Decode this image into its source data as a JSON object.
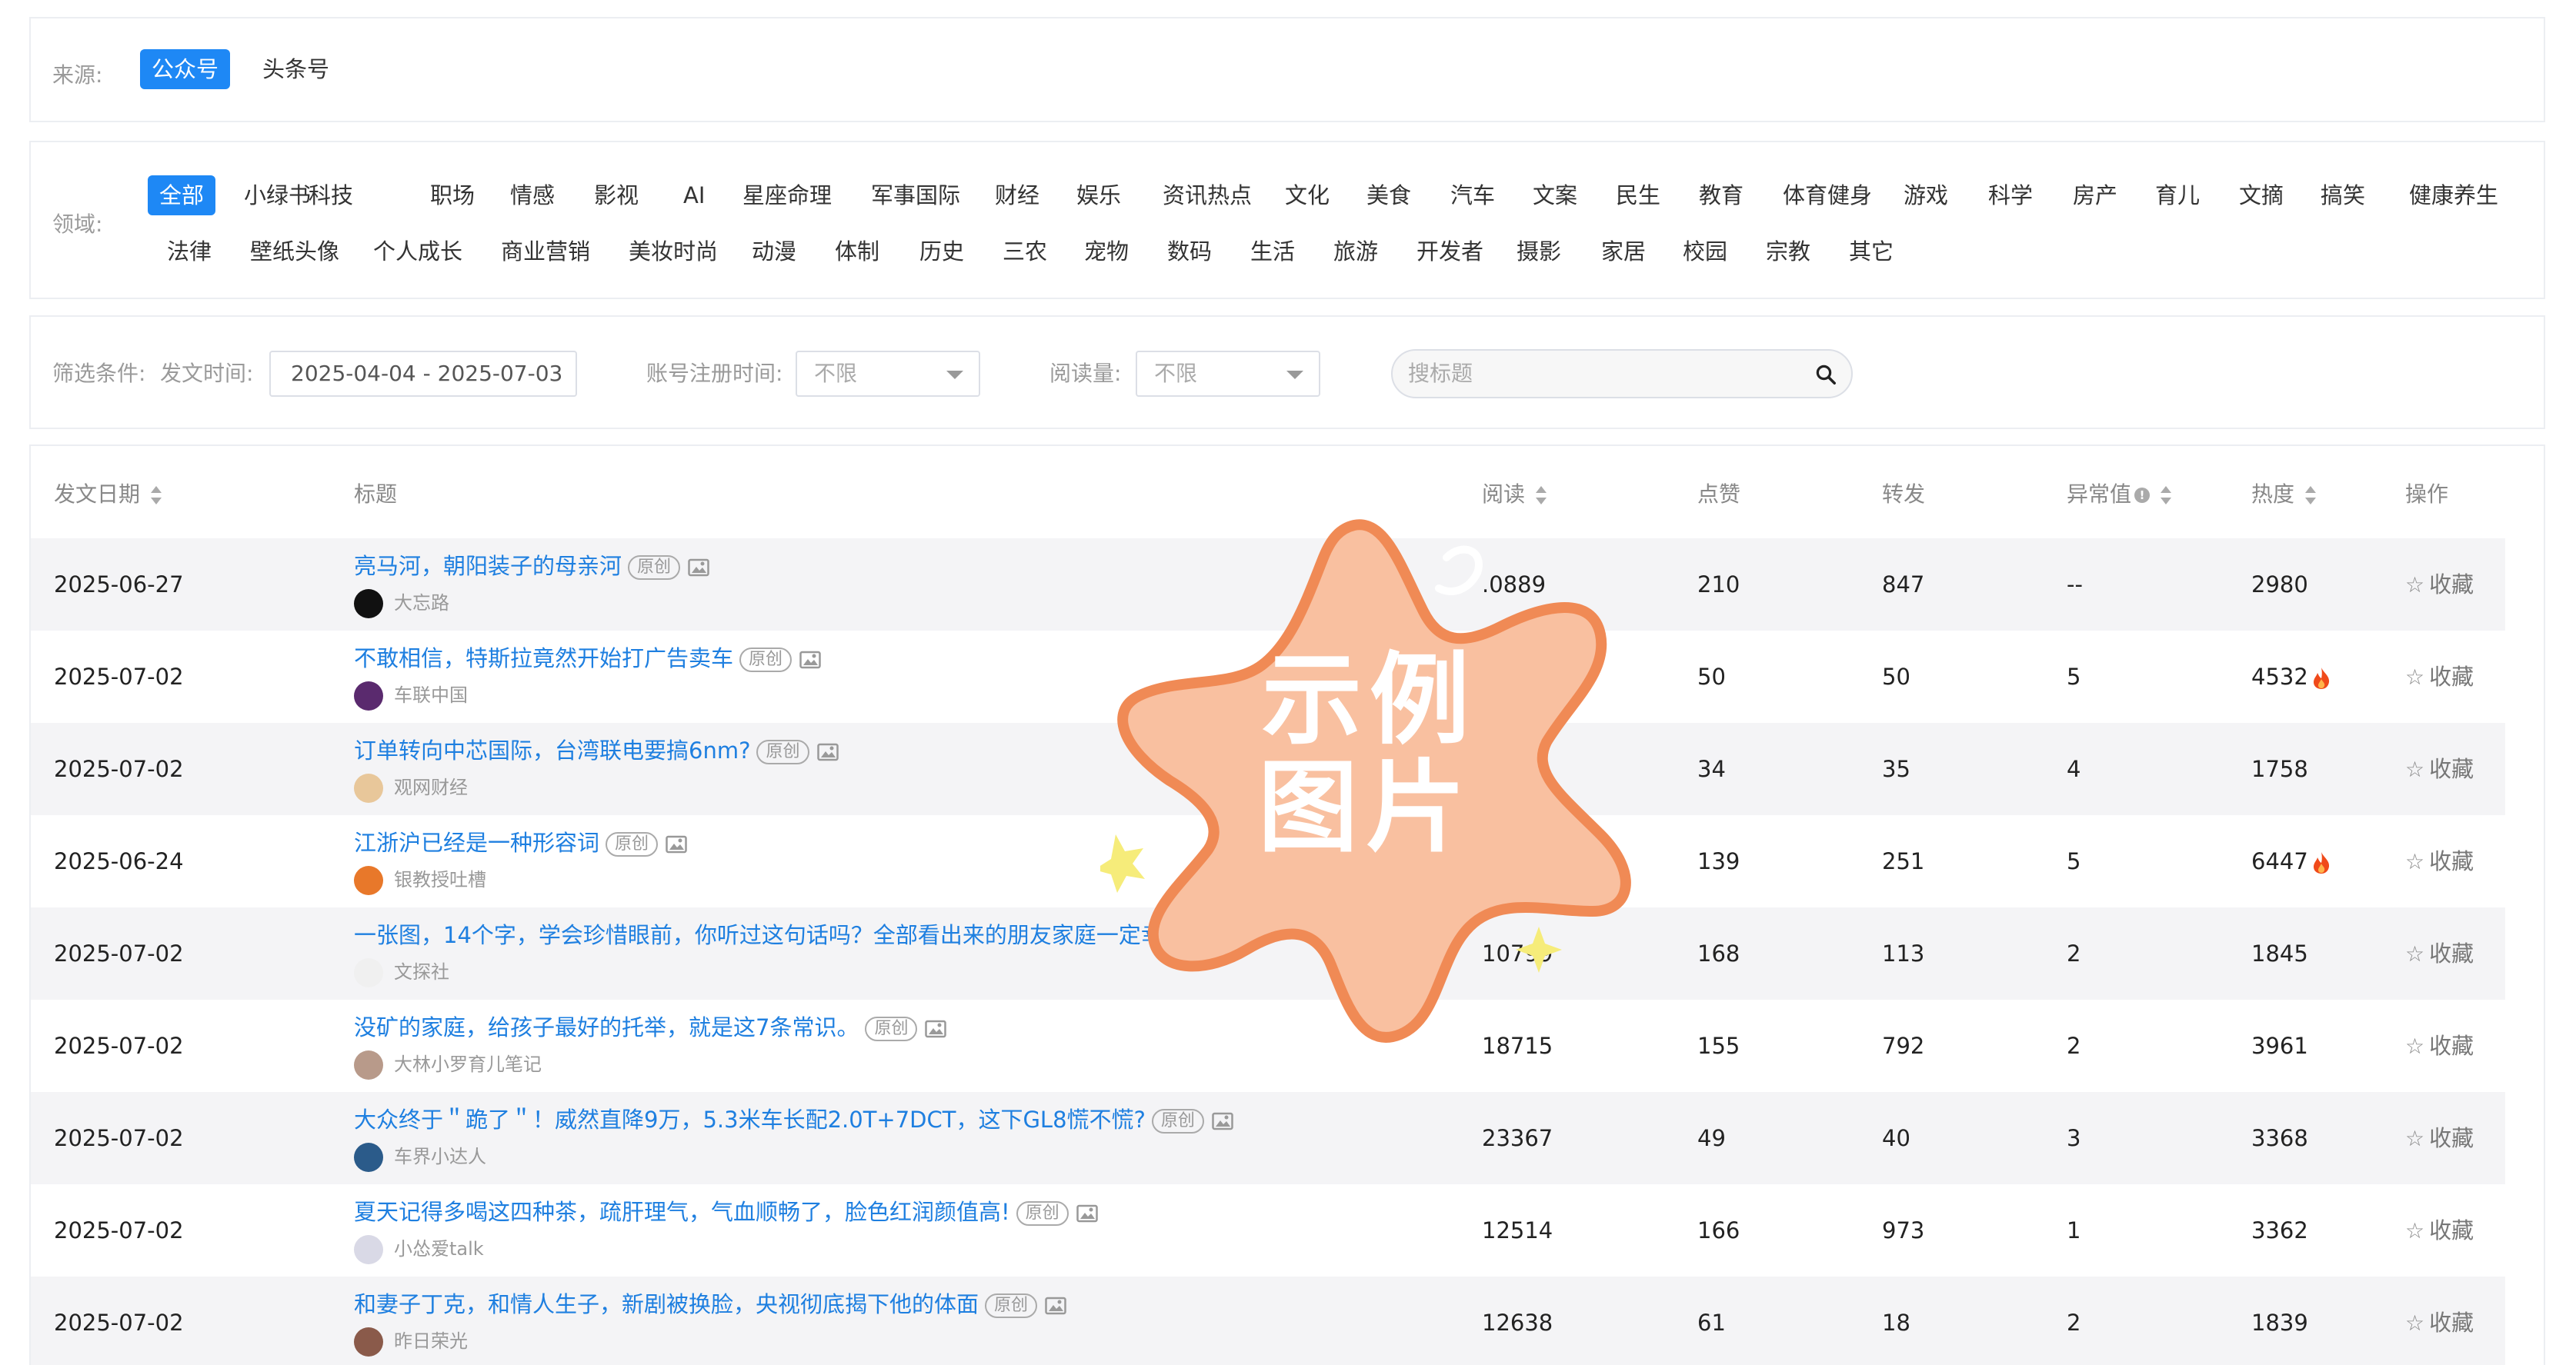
{
  "source": {
    "label": "来源:",
    "options": [
      "公众号",
      "头条号"
    ],
    "active": 0
  },
  "domain": {
    "label": "领域:",
    "row1": [
      "全部",
      "小绿书",
      "科技",
      "职场",
      "情感",
      "影视",
      "AI",
      "星座命理",
      "军事国际",
      "财经",
      "娱乐",
      "资讯热点",
      "文化",
      "美食",
      "汽车",
      "文案",
      "民生",
      "教育",
      "体育健身",
      "游戏",
      "科学",
      "房产",
      "育儿",
      "文摘",
      "搞笑",
      "健康养生"
    ],
    "row2": [
      "法律",
      "壁纸头像",
      "个人成长",
      "商业营销",
      "美妆时尚",
      "动漫",
      "体制",
      "历史",
      "三农",
      "宠物",
      "数码",
      "生活",
      "旅游",
      "开发者",
      "摄影",
      "家居",
      "校园",
      "宗教",
      "其它"
    ]
  },
  "filters": {
    "label": "筛选条件:",
    "post_time_label": "发文时间:",
    "post_time_value": "2025-04-04 - 2025-07-03",
    "reg_time_label": "账号注册时间:",
    "reg_time_value": "不限",
    "reads_label": "阅读量:",
    "reads_value": "不限",
    "search_placeholder": "搜标题"
  },
  "table": {
    "headers": {
      "date": "发文日期",
      "title": "标题",
      "reads": "阅读",
      "likes": "点赞",
      "shares": "转发",
      "anomaly": "异常值",
      "heat": "热度",
      "action": "操作"
    },
    "original_badge": "原创",
    "fav_label": "收藏",
    "rows": [
      {
        "date": "2025-06-27",
        "title": "亮马河，朝阳装子的母亲河",
        "original": true,
        "author": "大忘路",
        "avatar_color": "#111111",
        "reads": ".0889",
        "likes": "210",
        "shares": "847",
        "anomaly": "--",
        "heat": "2980",
        "hot": false
      },
      {
        "date": "2025-07-02",
        "title": "不敢相信，特斯拉竟然开始打广告卖车",
        "original": true,
        "author": "车联中国",
        "avatar_color": "#5a2a6e",
        "reads": "",
        "likes": "50",
        "shares": "50",
        "anomaly": "5",
        "heat": "4532",
        "hot": true
      },
      {
        "date": "2025-07-02",
        "title": "订单转向中芯国际，台湾联电要搞6nm?",
        "original": true,
        "author": "观网财经",
        "avatar_color": "#e8c79a",
        "reads": "",
        "likes": "34",
        "shares": "35",
        "anomaly": "4",
        "heat": "1758",
        "hot": false
      },
      {
        "date": "2025-06-24",
        "title": "江浙沪已经是一种形容词",
        "original": true,
        "author": "银教授吐槽",
        "avatar_color": "#e8782a",
        "reads": "",
        "likes": "139",
        "shares": "251",
        "anomaly": "5",
        "heat": "6447",
        "hot": true
      },
      {
        "date": "2025-07-02",
        "title": "一张图，14个字，学会珍惜眼前，你听过这句话吗？全部看出来的朋友家庭一定幸福",
        "original": false,
        "author": "文探社",
        "avatar_color": "#f0f0f0",
        "reads": "10799",
        "likes": "168",
        "shares": "113",
        "anomaly": "2",
        "heat": "1845",
        "hot": false
      },
      {
        "date": "2025-07-02",
        "title": "没矿的家庭，给孩子最好的托举，就是这7条常识。",
        "original": true,
        "author": "大林小罗育儿笔记",
        "avatar_color": "#b89a8a",
        "reads": "18715",
        "likes": "155",
        "shares": "792",
        "anomaly": "2",
        "heat": "3961",
        "hot": false
      },
      {
        "date": "2025-07-02",
        "title": "大众终于＂跪了＂！威然直降9万，5.3米车长配2.0T+7DCT，这下GL8慌不慌?",
        "original": true,
        "author": "车界小达人",
        "avatar_color": "#2b5b8a",
        "reads": "23367",
        "likes": "49",
        "shares": "40",
        "anomaly": "3",
        "heat": "3368",
        "hot": false
      },
      {
        "date": "2025-07-02",
        "title": "夏天记得多喝这四种茶，疏肝理气，气血顺畅了，脸色红润颜值高!",
        "original": true,
        "author": "小怂爱talk",
        "avatar_color": "#d9d9e6",
        "reads": "12514",
        "likes": "166",
        "shares": "973",
        "anomaly": "1",
        "heat": "3362",
        "hot": false
      },
      {
        "date": "2025-07-02",
        "title": "和妻子丁克，和情人生子，新剧被换脸，央视彻底揭下他的体面",
        "original": true,
        "author": "昨日荣光",
        "avatar_color": "#8a5a4a",
        "reads": "12638",
        "likes": "61",
        "shares": "18",
        "anomaly": "2",
        "heat": "1839",
        "hot": false
      }
    ]
  },
  "watermark": {
    "line1": "示例",
    "line2": "图片",
    "fill": "#f9c0a0",
    "stroke": "#f08a55"
  }
}
